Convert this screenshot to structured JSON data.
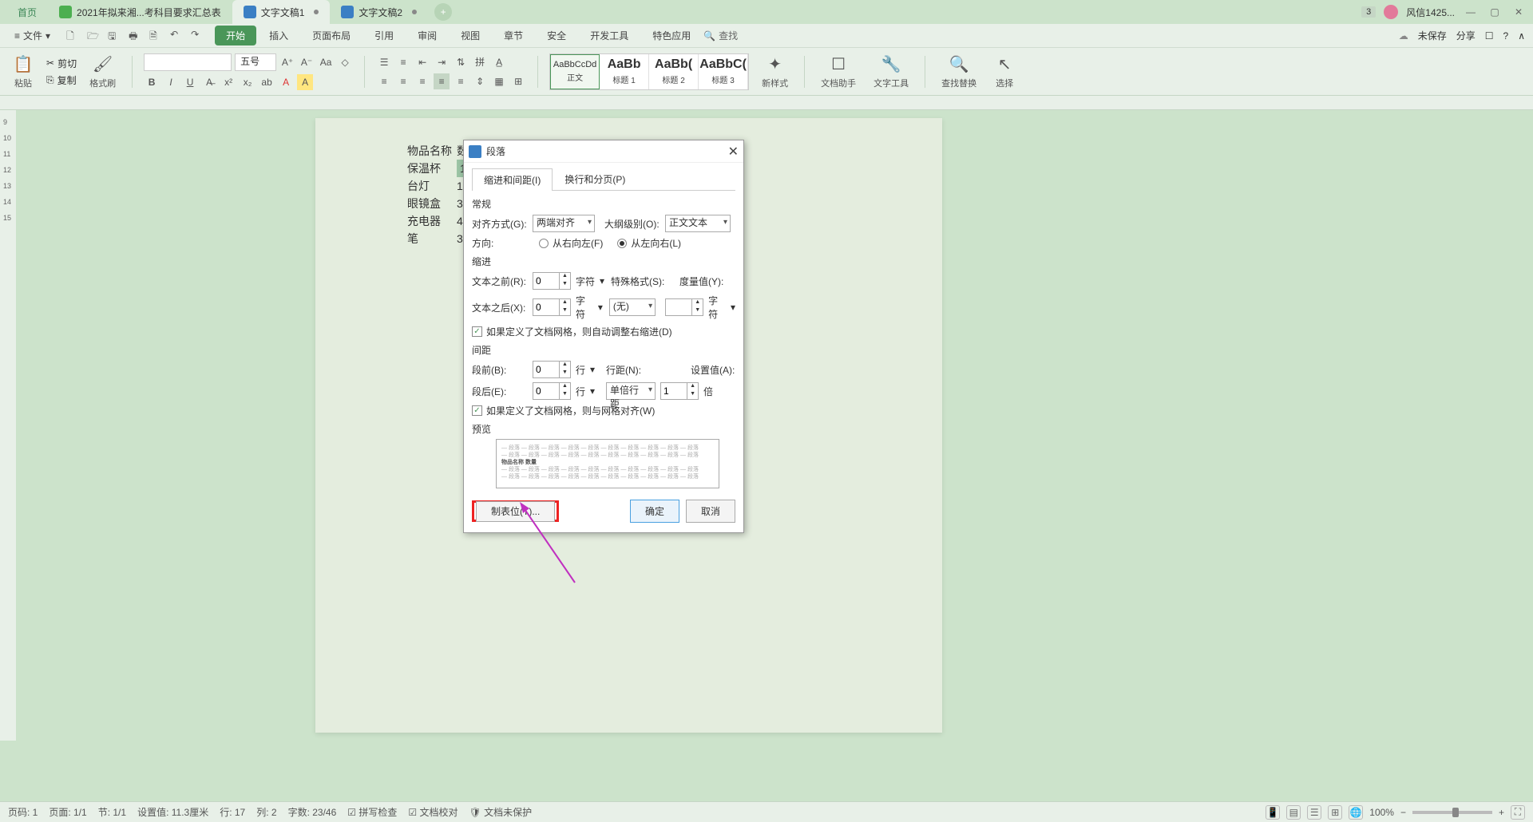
{
  "tabs": {
    "home": "首页",
    "tab1": "2021年拟来湘...考科目要求汇总表",
    "tab2": "文字文稿1",
    "tab3": "文字文稿2",
    "badge": "3",
    "user": "风信1425..."
  },
  "menu": {
    "file": "文件",
    "items": [
      "开始",
      "插入",
      "页面布局",
      "引用",
      "审阅",
      "视图",
      "章节",
      "安全",
      "开发工具",
      "特色应用"
    ],
    "search_placeholder": "查找",
    "unsaved": "未保存",
    "share": "分享"
  },
  "ribbon": {
    "paste": "粘贴",
    "cut": "剪切",
    "copy": "复制",
    "format_painter": "格式刷",
    "font_size": "五号",
    "styles": [
      {
        "preview": "AaBbCcDd",
        "name": "正文"
      },
      {
        "preview": "AaBb",
        "name": "标题 1"
      },
      {
        "preview": "AaBb(",
        "name": "标题 2"
      },
      {
        "preview": "AaBbC(",
        "name": "标题 3"
      }
    ],
    "new_style": "新样式",
    "doc_assistant": "文档助手",
    "text_tools": "文字工具",
    "find_replace": "查找替换",
    "select": "选择"
  },
  "doc": {
    "rows": [
      {
        "c1": "物品名称",
        "c2": "数",
        "hi": false
      },
      {
        "c1": "保温杯",
        "c2": "1",
        "hi": true
      },
      {
        "c1": "台灯",
        "c2": "1",
        "hi": false
      },
      {
        "c1": "眼镜盒",
        "c2": "3",
        "hi": false
      },
      {
        "c1": "充电器",
        "c2": "4",
        "hi": false
      },
      {
        "c1": "笔",
        "c2": "3",
        "hi": false
      }
    ]
  },
  "dialog": {
    "title": "段落",
    "tabs": [
      "缩进和间距(I)",
      "换行和分页(P)"
    ],
    "section_general": "常规",
    "alignment_label": "对齐方式(G):",
    "alignment_value": "两端对齐",
    "outline_label": "大纲级别(O):",
    "outline_value": "正文文本",
    "direction_label": "方向:",
    "dir_rtl": "从右向左(F)",
    "dir_ltr": "从左向右(L)",
    "section_indent": "缩进",
    "before_text_label": "文本之前(R):",
    "before_text_value": "0",
    "after_text_label": "文本之后(X):",
    "after_text_value": "0",
    "char_unit": "字符",
    "special_label": "特殊格式(S):",
    "special_value": "(无)",
    "measure_label": "度量值(Y):",
    "auto_indent_chk": "如果定义了文档网格，则自动调整右缩进(D)",
    "section_spacing": "间距",
    "before_p_label": "段前(B):",
    "before_p_value": "0",
    "after_p_label": "段后(E):",
    "after_p_value": "0",
    "line_unit": "行",
    "line_spacing_label": "行距(N):",
    "line_spacing_value": "单倍行距",
    "set_value_label": "设置值(A):",
    "set_value": "1",
    "times_unit": "倍",
    "snap_grid_chk": "如果定义了文档网格，则与网格对齐(W)",
    "section_preview": "预览",
    "preview_text": "物品名称 数量",
    "tab_stops_btn": "制表位(T)...",
    "ok_btn": "确定",
    "cancel_btn": "取消"
  },
  "status": {
    "page_label": "页码: 1",
    "pages": "页面: 1/1",
    "section": "节: 1/1",
    "set_value": "设置值: 11.3厘米",
    "line": "行: 17",
    "column": "列: 2",
    "chars": "字数: 23/46",
    "spell": "拼写检查",
    "proof": "文档校对",
    "protect": "文档未保护",
    "zoom": "100%"
  }
}
